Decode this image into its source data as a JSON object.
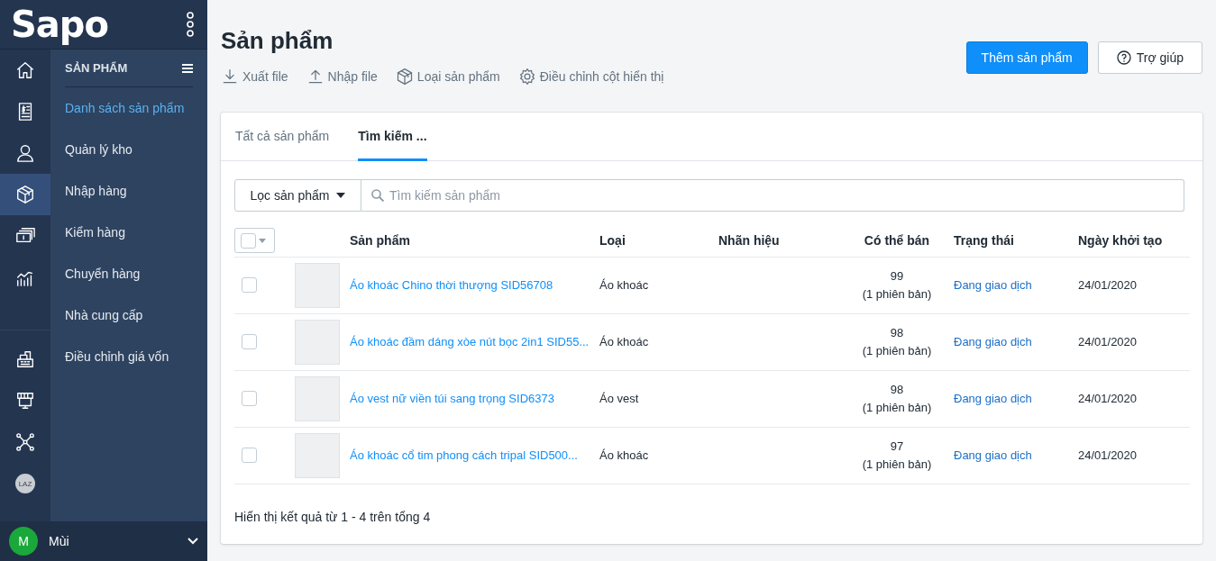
{
  "brand": {
    "logo": "Sapo"
  },
  "rail": [
    {
      "kind": "home",
      "selected": false
    },
    {
      "kind": "invoice",
      "selected": false
    },
    {
      "kind": "user",
      "selected": false
    },
    {
      "kind": "box",
      "selected": true
    },
    {
      "kind": "money",
      "selected": false
    },
    {
      "kind": "chart",
      "selected": false
    }
  ],
  "rail_bottom": [
    {
      "kind": "cashier"
    },
    {
      "kind": "store"
    },
    {
      "kind": "network"
    },
    {
      "kind": "badge",
      "label": "LAZ"
    }
  ],
  "submenu": {
    "title": "SẢN PHẨM",
    "items": [
      {
        "label": "Danh sách sản phẩm",
        "selected": true
      },
      {
        "label": "Quản lý kho",
        "selected": false
      },
      {
        "label": "Nhập hàng",
        "selected": false
      },
      {
        "label": "Kiểm hàng",
        "selected": false
      },
      {
        "label": "Chuyển hàng",
        "selected": false
      },
      {
        "label": "Nhà cung cấp",
        "selected": false
      },
      {
        "label": "Điều chỉnh giá vốn",
        "selected": false
      }
    ]
  },
  "user": {
    "initial": "M",
    "name": "Mùi"
  },
  "page": {
    "title": "Sản phẩm",
    "actions": [
      {
        "kind": "download",
        "label": "Xuất file"
      },
      {
        "kind": "upload",
        "label": "Nhập file"
      },
      {
        "kind": "box",
        "label": "Loại sản phẩm"
      },
      {
        "kind": "gear",
        "label": "Điều chỉnh cột hiển thị"
      }
    ],
    "primary_button": "Thêm sản phẩm",
    "help_button": "Trợ giúp"
  },
  "tabs": [
    {
      "label": "Tất cả sản phẩm",
      "selected": false
    },
    {
      "label": "Tìm kiếm ...",
      "selected": true
    }
  ],
  "filter": {
    "label": "Lọc sản phẩm",
    "placeholder": "Tìm kiếm sản phẩm"
  },
  "table": {
    "select_all_checked": false,
    "columns": [
      "Sản phẩm",
      "Loại",
      "Nhãn hiệu",
      "Có thể bán",
      "Trạng thái",
      "Ngày khởi tạo"
    ],
    "rows": [
      {
        "checked": false,
        "name": "Áo khoác Chino thời thượng SID56708",
        "type": "Áo khoác",
        "available": "99",
        "variants": "(1 phiên bản)",
        "status": "Đang giao dịch",
        "created": "24/01/2020"
      },
      {
        "checked": false,
        "name": "Áo khoác đầm dáng xòe nút bọc 2in1 SID55...",
        "type": "Áo khoác",
        "available": "98",
        "variants": "(1 phiên bản)",
        "status": "Đang giao dịch",
        "created": "24/01/2020"
      },
      {
        "checked": false,
        "name": "Áo vest nữ viền túi sang trọng SID6373",
        "type": "Áo vest",
        "available": "98",
        "variants": "(1 phiên bản)",
        "status": "Đang giao dịch",
        "created": "24/01/2020"
      },
      {
        "checked": false,
        "name": "Áo khoác cổ tim phong cách tripal SID500...",
        "type": "Áo khoác",
        "available": "97",
        "variants": "(1 phiên bản)",
        "status": "Đang giao dịch",
        "created": "24/01/2020"
      }
    ]
  },
  "summary": "Hiển thị kết quả từ 1 - 4 trên tổng 4"
}
